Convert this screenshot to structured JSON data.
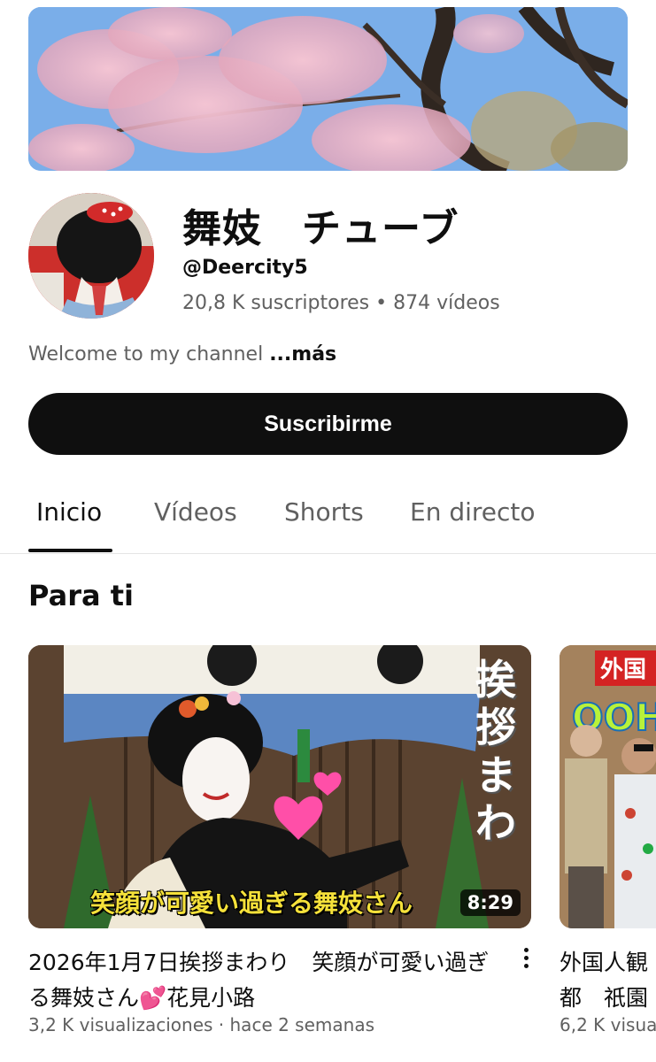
{
  "channel": {
    "name": "舞妓　チューブ",
    "handle": "@Deercity5",
    "subscribers": "20,8 K suscriptores",
    "separator": "•",
    "videos": "874 vídeos",
    "description": "Welcome to my channel ",
    "more_label": "...más"
  },
  "subscribe_label": "Suscribirme",
  "tabs": [
    {
      "label": "Inicio",
      "active": true
    },
    {
      "label": "Vídeos",
      "active": false
    },
    {
      "label": "Shorts",
      "active": false
    },
    {
      "label": "En directo",
      "active": false
    }
  ],
  "section": {
    "title": "Para ti"
  },
  "videos": [
    {
      "title": "2026年1月7日挨拶まわり　笑顔が可愛い過ぎる舞妓さん💕花見小路",
      "meta": "3,2 K visualizaciones · hace 2 semanas",
      "duration": "8:29",
      "overlay_caption": "笑顔が可愛い過ぎる舞妓さん",
      "overlay_vertical": "挨拶まわ"
    },
    {
      "title": "外国人観光客 京都　祇園",
      "title_line1": "外国人観",
      "title_line2": "都　祇園",
      "meta": "6,2 K visualiza",
      "overlay_top": "外国",
      "overlay_word": "OOH"
    }
  ],
  "icons": {
    "more_vert": "more-vert-icon"
  }
}
